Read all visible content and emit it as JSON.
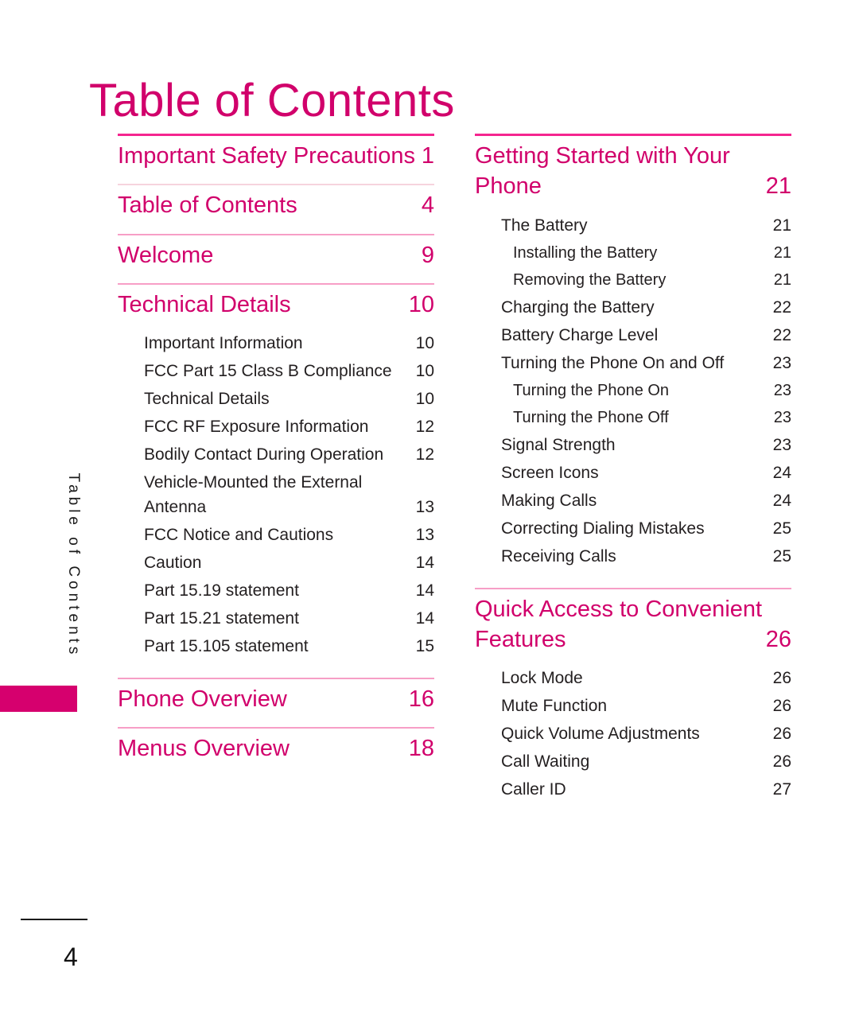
{
  "page": {
    "title": "Table of Contents",
    "page_number": "4",
    "side_tab_label": "Table of Contents",
    "accent_color": "#d1006b",
    "tab_color": "#d6006e"
  },
  "left_column": {
    "sections": [
      {
        "title": "Important Safety Precautions",
        "page": "1",
        "wrapped": true,
        "entries": []
      },
      {
        "title": "Table of Contents",
        "page": "4",
        "wrapped": false,
        "entries": []
      },
      {
        "title": "Welcome",
        "page": "9",
        "wrapped": false,
        "entries": []
      },
      {
        "title": "Technical Details",
        "page": "10",
        "wrapped": false,
        "entries": [
          {
            "label": "Important Information",
            "page": "10",
            "level": 1
          },
          {
            "label": "FCC Part 15 Class B Compliance",
            "page": "10",
            "level": 1
          },
          {
            "label": "Technical Details",
            "page": "10",
            "level": 1
          },
          {
            "label": "FCC RF Exposure Information",
            "page": "12",
            "level": 1
          },
          {
            "label": "Bodily Contact During Operation",
            "page": "12",
            "level": 1
          },
          {
            "label": "Vehicle-Mounted the External",
            "label2": "Antenna",
            "page": "13",
            "level": 1,
            "wrap": true
          },
          {
            "label": "FCC Notice and Cautions",
            "page": "13",
            "level": 1
          },
          {
            "label": "Caution",
            "page": "14",
            "level": 1
          },
          {
            "label": "Part 15.19 statement",
            "page": "14",
            "level": 1
          },
          {
            "label": "Part 15.21 statement",
            "page": "14",
            "level": 1
          },
          {
            "label": "Part 15.105 statement",
            "page": "15",
            "level": 1
          }
        ]
      },
      {
        "title": "Phone Overview",
        "page": "16",
        "wrapped": false,
        "entries": []
      },
      {
        "title": "Menus Overview",
        "page": "18",
        "wrapped": false,
        "entries": []
      }
    ]
  },
  "right_column": {
    "sections": [
      {
        "title": "Getting Started with Your Phone",
        "page": "21",
        "wrapped": true,
        "entries": [
          {
            "label": "The Battery",
            "page": "21",
            "level": 1
          },
          {
            "label": "Installing the Battery",
            "page": "21",
            "level": 2
          },
          {
            "label": "Removing the Battery",
            "page": "21",
            "level": 2
          },
          {
            "label": "Charging the Battery",
            "page": "22",
            "level": 1
          },
          {
            "label": "Battery Charge Level",
            "page": "22",
            "level": 1
          },
          {
            "label": "Turning the Phone On and Off",
            "page": "23",
            "level": 1
          },
          {
            "label": "Turning the Phone On",
            "page": "23",
            "level": 2
          },
          {
            "label": "Turning the Phone Off",
            "page": "23",
            "level": 2
          },
          {
            "label": "Signal Strength",
            "page": "23",
            "level": 1
          },
          {
            "label": "Screen Icons",
            "page": "24",
            "level": 1
          },
          {
            "label": "Making Calls",
            "page": "24",
            "level": 1
          },
          {
            "label": "Correcting Dialing Mistakes",
            "page": "25",
            "level": 1
          },
          {
            "label": "Receiving Calls",
            "page": "25",
            "level": 1
          }
        ]
      },
      {
        "title": "Quick Access to Convenient Features",
        "page": "26",
        "wrapped": true,
        "entries": [
          {
            "label": "Lock Mode",
            "page": "26",
            "level": 1
          },
          {
            "label": "Mute Function",
            "page": "26",
            "level": 1
          },
          {
            "label": "Quick Volume Adjustments",
            "page": "26",
            "level": 1
          },
          {
            "label": "Call Waiting",
            "page": "26",
            "level": 1
          },
          {
            "label": "Caller ID",
            "page": "27",
            "level": 1
          }
        ]
      }
    ]
  }
}
